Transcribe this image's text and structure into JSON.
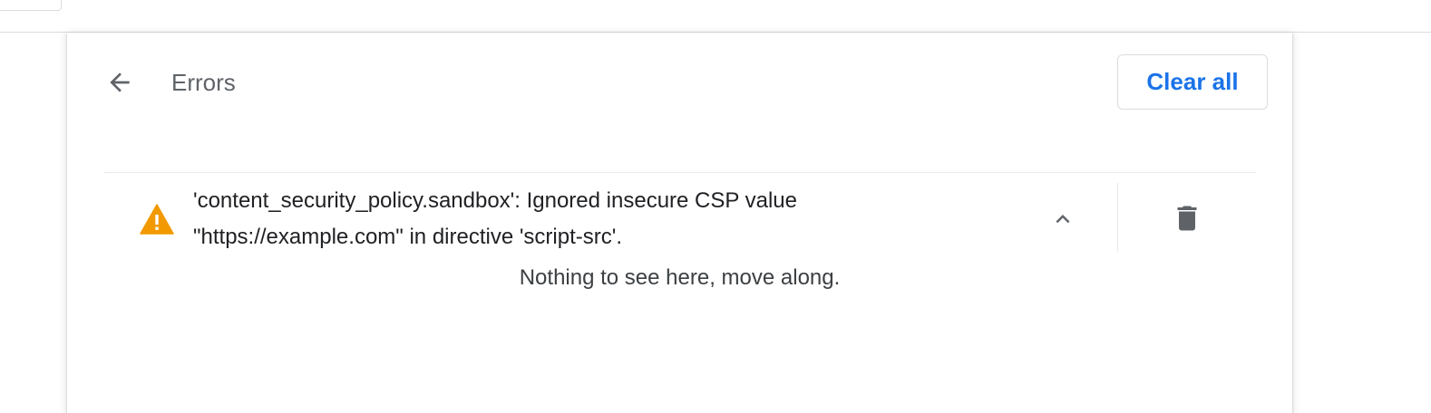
{
  "header": {
    "title": "Errors",
    "back_icon": "arrow-back-icon",
    "clear_all_label": "Clear all"
  },
  "errors": [
    {
      "severity_icon": "warning-icon",
      "severity_color": "#f29900",
      "line1": "'content_security_policy.sandbox': Ignored insecure CSP value",
      "line2": "\"https://example.com\" in directive 'script-src'.",
      "expand_icon": "chevron-up-icon",
      "delete_icon": "trash-icon"
    }
  ],
  "details": {
    "empty_text": "Nothing to see here, move along."
  },
  "colors": {
    "accent": "#1a73e8",
    "icon": "#5f6368",
    "warning": "#f29900"
  }
}
